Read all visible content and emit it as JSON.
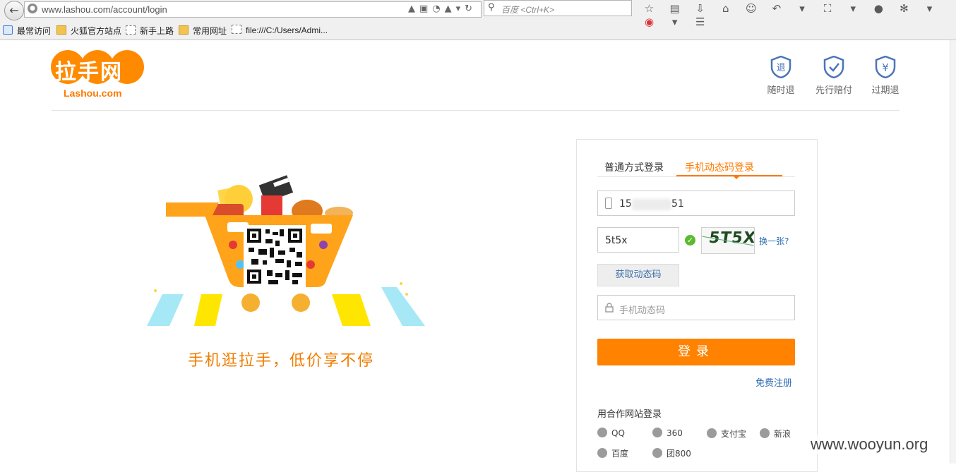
{
  "browser": {
    "url": "www.lashou.com/account/login",
    "search_placeholder": "百度 <Ctrl+K>",
    "bookmarks": [
      "最常访问",
      "火狐官方站点",
      "新手上路",
      "常用网址",
      "file:///C:/Users/Admi..."
    ]
  },
  "header": {
    "logo_text": "拉手网",
    "logo_sub": "Lashou.com",
    "promises": [
      {
        "icon": "refund-shield-icon",
        "glyph": "退",
        "label": "随时退"
      },
      {
        "icon": "check-shield-icon",
        "glyph": "✓",
        "label": "先行赔付"
      },
      {
        "icon": "yen-shield-icon",
        "glyph": "¥",
        "label": "过期退"
      }
    ]
  },
  "promo": {
    "slogan": "手机逛拉手，低价享不停"
  },
  "login": {
    "tabs": [
      "普通方式登录",
      "手机动态码登录"
    ],
    "active_tab": "手机动态码登录",
    "phone_prefix": "15",
    "phone_suffix": "51",
    "captcha_value": "5t5x",
    "captcha_image_text": "5T5X",
    "refresh_captcha": "换一张?",
    "get_code_button": "获取动态码",
    "code_placeholder": "手机动态码",
    "submit": "登录",
    "register_link": "免费注册",
    "partner_title": "用合作网站登录",
    "partners": [
      "QQ",
      "360",
      "支付宝",
      "新浪",
      "百度",
      "团800"
    ]
  },
  "watermark": "www.wooyun.org",
  "colors": {
    "accent": "#ff8200",
    "link": "#2d6cb3",
    "success": "#5cba2f"
  }
}
